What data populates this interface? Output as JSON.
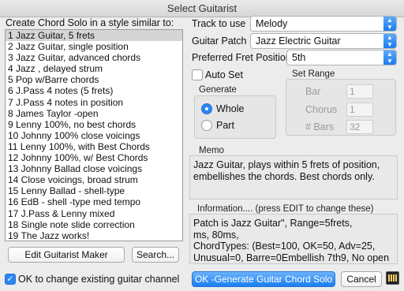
{
  "window": {
    "title": "Select Guitarist"
  },
  "list": {
    "heading": "Create Chord Solo in a style similar to:",
    "items": [
      "1 Jazz Guitar, 5 frets",
      "2 Jazz Guitar, single position",
      "3 Jazz Guitar, advanced chords",
      "4 Jazz , delayed strum",
      "5 Pop w/Barre chords",
      "6 J.Pass 4 notes (5 frets)",
      "7 J.Pass 4 notes in position",
      "8 James Taylor -open",
      "9 Lenny 100%, no best chords",
      "10 Johnny 100% close voicings",
      "11 Lenny 100%, with Best Chords",
      "12 Johnny 100%, w/ Best Chords",
      "13 Johnny Ballad close voicings",
      "14 Close voicings, broad strum",
      "15 Lenny Ballad - shell-type",
      "16 EdB - shell -type med tempo",
      "17 J.Pass & Lenny mixed",
      "18 Single note slide correction",
      "19 The Jazz works!"
    ],
    "selected_index": 0
  },
  "buttons": {
    "edit_guitarist_maker": "Edit Guitarist Maker",
    "search": "Search...",
    "ok_generate": "OK -Generate Guitar Chord Solo",
    "cancel": "Cancel"
  },
  "checkbox_change_channel": {
    "label": "OK to change existing guitar channel",
    "checked": true
  },
  "track": {
    "label": "Track to use",
    "value": "Melody"
  },
  "patch": {
    "label": "Guitar Patch",
    "value": "Jazz Electric Guitar"
  },
  "fret": {
    "label": "Preferred Fret Position",
    "value": "5th"
  },
  "auto_set": {
    "label": "Auto Set",
    "checked": false
  },
  "generate": {
    "title": "Generate",
    "whole_label": "Whole",
    "part_label": "Part",
    "selected": "whole"
  },
  "set_range": {
    "title": "Set Range",
    "bar_label": "Bar",
    "bar_value": "1",
    "chorus_label": "Chorus",
    "chorus_value": "1",
    "bars_label": "# Bars",
    "bars_value": "32"
  },
  "memo": {
    "title": "Memo",
    "text": "Jazz Guitar, plays within 5 frets of position, embellishes the chords. Best chords only."
  },
  "information": {
    "title": "Information.... (press EDIT to change these)",
    "line1": "Patch is Jazz Guitar\", Range=5frets,",
    "line2": "ms, 80ms,",
    "line3": "ChordTypes: (Best=100, OK=50, Adv=25,",
    "line4": "Unusual=0, Barre=0Embellish 7th9, No open"
  },
  "icons": {
    "app_icon": "band-in-a-box-icon"
  },
  "colors": {
    "accent": "#1a7ff0",
    "selection": "#d5d5d5"
  }
}
